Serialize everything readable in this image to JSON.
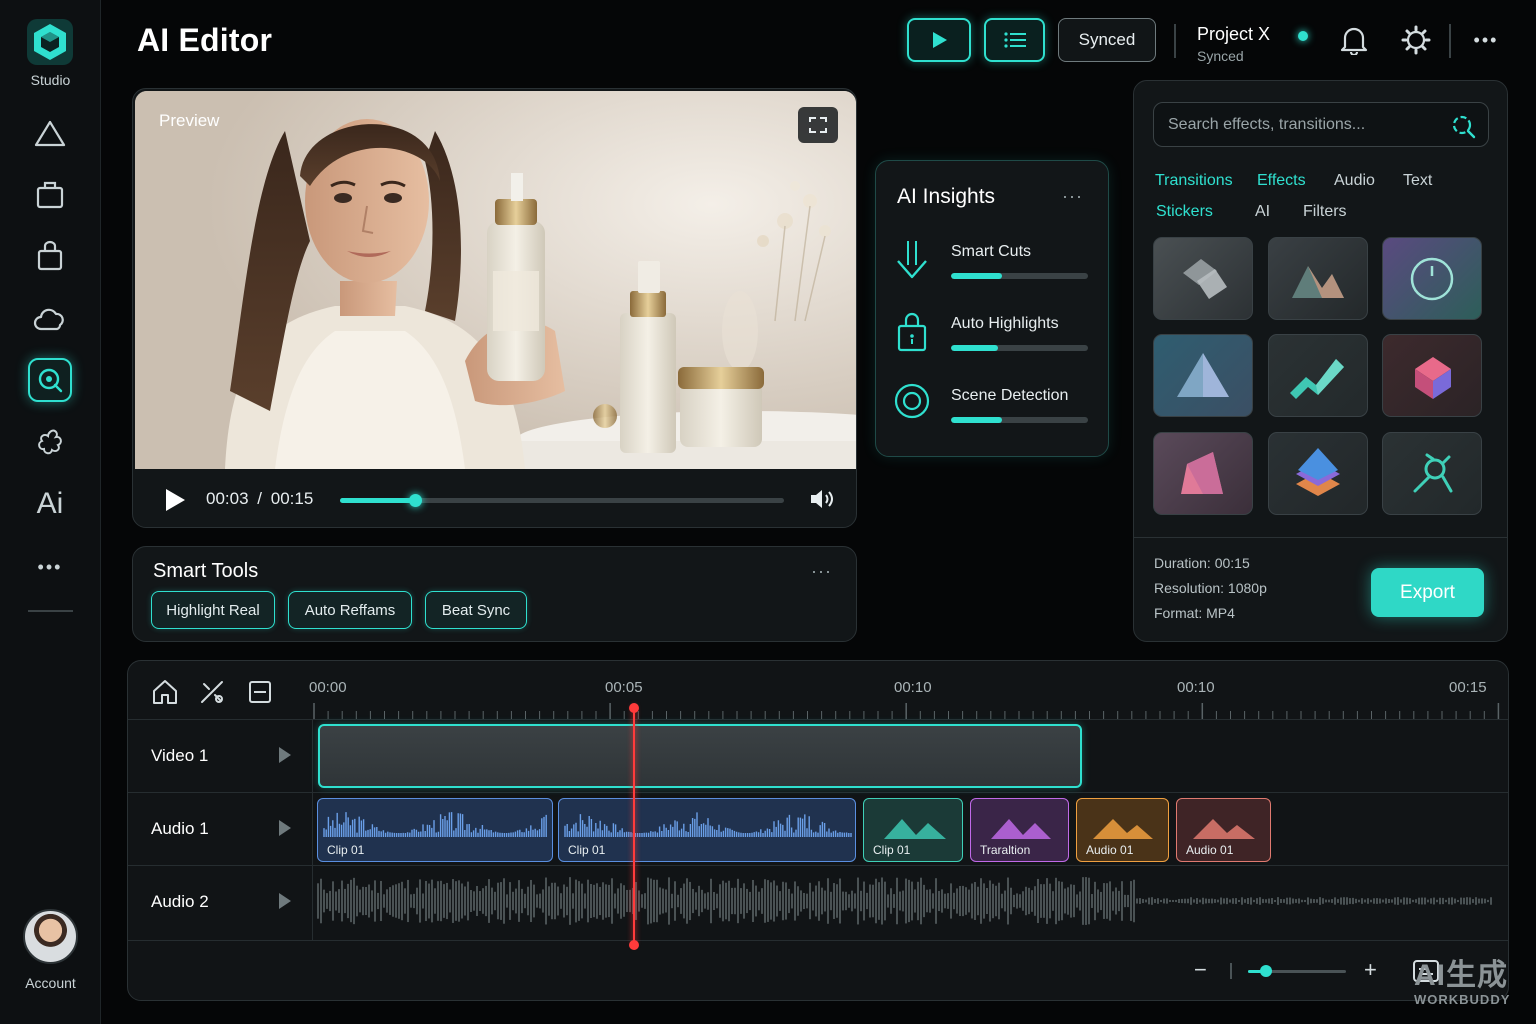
{
  "sidebar": {
    "logo_label": "Studio",
    "items": [
      {
        "icon": "triangle-icon"
      },
      {
        "icon": "box-icon"
      },
      {
        "icon": "bag-icon"
      },
      {
        "icon": "cloud-icon"
      },
      {
        "icon": "ai-search-icon",
        "active": true
      },
      {
        "icon": "flower-icon"
      },
      {
        "icon": "ai-text-icon",
        "text": "Ai"
      },
      {
        "icon": "more-icon",
        "text": "•••"
      }
    ],
    "account_label": "Account"
  },
  "header": {
    "title": "AI Editor",
    "synced_label": "Synced",
    "project_title": "Project X",
    "project_status": "Synced",
    "more_label": "•••"
  },
  "preview": {
    "label": "Preview",
    "current_time": "00:03",
    "separator": "/",
    "duration": "00:15",
    "progress": 0.17
  },
  "smart_tools": {
    "title": "Smart Tools",
    "more_label": "···",
    "chips": [
      "Highlight Real",
      "Auto Reffams",
      "Beat Sync"
    ]
  },
  "insights": {
    "title": "AI Insights",
    "more_label": "···",
    "items": [
      {
        "label": "Smart Cuts",
        "progress": 0.37,
        "icon": "download-arrow-icon"
      },
      {
        "label": "Auto Highlights",
        "progress": 0.34,
        "icon": "lock-icon"
      },
      {
        "label": "Scene Detection",
        "progress": 0.37,
        "icon": "target-icon"
      }
    ]
  },
  "effects": {
    "search_placeholder": "Search effects, transitions...",
    "tabs": [
      {
        "label": "Transitions",
        "active": true
      },
      {
        "label": "Effects",
        "active": true
      },
      {
        "label": "Audio",
        "active": false
      },
      {
        "label": "Text",
        "active": false
      },
      {
        "label": "Stickers",
        "active": true
      },
      {
        "label": "AI",
        "active": false
      },
      {
        "label": "Filters",
        "active": false
      }
    ],
    "tiles": [
      "shapes-icon",
      "mountain-icon",
      "circle-ring-icon",
      "triangle-glass-icon",
      "chart-ribbon-icon",
      "cube-pink-icon",
      "prism-pink-icon",
      "stack-layers-icon",
      "orbit-icon"
    ],
    "meta": {
      "duration": "Duration: 00:15",
      "resolution": "Resolution: 1080p",
      "format": "Format: MP4"
    },
    "export_label": "Export"
  },
  "timeline": {
    "ticks": [
      "00:00",
      "00:05",
      "00:10",
      "00:10",
      "00:15"
    ],
    "tracks": [
      {
        "label": "Video 1"
      },
      {
        "label": "Audio 1"
      },
      {
        "label": "Audio 2"
      }
    ],
    "audio_clips": [
      {
        "name": "Clip 01",
        "color": "#5a8fe0"
      },
      {
        "name": "Clip 01",
        "color": "#5a8fe0"
      },
      {
        "name": "Clip 01",
        "color": "#3fd0b8"
      },
      {
        "name": "Traraltion",
        "color": "#c06ae8"
      },
      {
        "name": "Audio 01",
        "color": "#f0a040"
      },
      {
        "name": "Audio 01",
        "color": "#e07a70"
      }
    ],
    "zoom_minus": "−",
    "zoom_plus": "+",
    "zoom_level": 0.18
  },
  "watermark": {
    "line1": "AI生成",
    "line2": "WORKBUDDY"
  },
  "colors": {
    "accent": "#2fe0cf",
    "playhead": "#ff3b3b",
    "background": "#050607"
  }
}
